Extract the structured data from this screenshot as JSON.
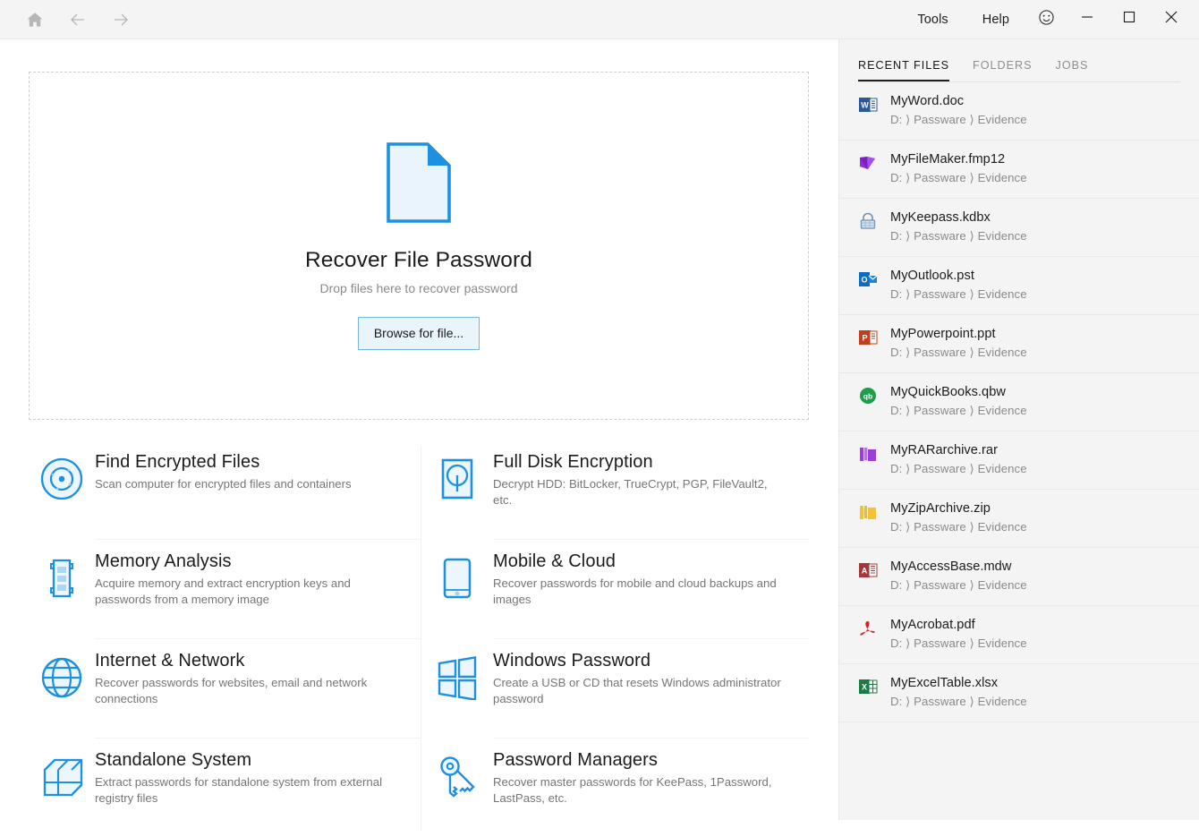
{
  "titlebar": {
    "nav": [
      {
        "name": "home-icon",
        "label": "Home"
      },
      {
        "name": "back-icon",
        "label": "Back"
      },
      {
        "name": "forward-icon",
        "label": "Forward"
      }
    ],
    "menus": [
      {
        "label": "Tools"
      },
      {
        "label": "Help"
      }
    ],
    "smiley_icon": "smiley-icon",
    "window_controls": [
      {
        "name": "minimize-button",
        "glyph": "─"
      },
      {
        "name": "maximize-button",
        "glyph": "□"
      },
      {
        "name": "close-button",
        "glyph": "✕"
      }
    ]
  },
  "dropzone": {
    "icon": "document-icon",
    "title": "Recover File Password",
    "subtitle": "Drop files here to recover password",
    "button": "Browse for file..."
  },
  "features": {
    "left": [
      {
        "icon": "radar-target-icon",
        "title": "Find Encrypted Files",
        "desc": "Scan computer for encrypted files and containers"
      },
      {
        "icon": "memory-module-icon",
        "title": "Memory Analysis",
        "desc": "Acquire memory and extract encryption keys and passwords from a memory image"
      },
      {
        "icon": "globe-icon",
        "title": "Internet & Network",
        "desc": "Recover passwords for websites, email and network connections"
      },
      {
        "icon": "cube-icon",
        "title": "Standalone System",
        "desc": "Extract passwords for standalone system from external registry files"
      }
    ],
    "right": [
      {
        "icon": "hard-disk-icon",
        "title": "Full Disk Encryption",
        "desc": "Decrypt HDD: BitLocker, TrueCrypt, PGP, FileVault2, etc."
      },
      {
        "icon": "mobile-phone-icon",
        "title": "Mobile & Cloud",
        "desc": "Recover passwords for mobile and cloud backups and images"
      },
      {
        "icon": "windows-logo-icon",
        "title": "Windows Password",
        "desc": "Create a USB or CD that resets Windows administrator password"
      },
      {
        "icon": "keys-icon",
        "title": "Password Managers",
        "desc": "Recover master passwords for KeePass, 1Password, LastPass, etc."
      }
    ]
  },
  "sidebar": {
    "tabs": [
      {
        "label": "RECENT FILES",
        "active": true
      },
      {
        "label": "FOLDERS",
        "active": false
      },
      {
        "label": "JOBS",
        "active": false
      }
    ],
    "files": [
      {
        "icon": "word-file-icon",
        "name": "MyWord.doc",
        "path": "D: ⟩ Passware ⟩ Evidence"
      },
      {
        "icon": "filemaker-file-icon",
        "name": "MyFileMaker.fmp12",
        "path": "D: ⟩ Passware ⟩ Evidence"
      },
      {
        "icon": "keepass-file-icon",
        "name": "MyKeepass.kdbx",
        "path": "D: ⟩ Passware ⟩ Evidence"
      },
      {
        "icon": "outlook-file-icon",
        "name": "MyOutlook.pst",
        "path": "D: ⟩ Passware ⟩ Evidence"
      },
      {
        "icon": "powerpoint-file-icon",
        "name": "MyPowerpoint.ppt",
        "path": "D: ⟩ Passware ⟩ Evidence"
      },
      {
        "icon": "quickbooks-file-icon",
        "name": "MyQuickBooks.qbw",
        "path": "D: ⟩ Passware ⟩ Evidence"
      },
      {
        "icon": "rar-file-icon",
        "name": "MyRARarchive.rar",
        "path": "D: ⟩ Passware ⟩ Evidence"
      },
      {
        "icon": "zip-file-icon",
        "name": "MyZipArchive.zip",
        "path": "D: ⟩ Passware ⟩ Evidence"
      },
      {
        "icon": "access-file-icon",
        "name": "MyAccessBase.mdw",
        "path": "D: ⟩ Passware ⟩ Evidence"
      },
      {
        "icon": "acrobat-file-icon",
        "name": "MyAcrobat.pdf",
        "path": "D: ⟩ Passware ⟩ Evidence"
      },
      {
        "icon": "excel-file-icon",
        "name": "MyExcelTable.xlsx",
        "path": "D: ⟩ Passware ⟩ Evidence"
      }
    ]
  },
  "colors": {
    "accent_blue": "#1e90e0",
    "icon_fill": "#ecf6fd",
    "titlebar_bg": "#f4f4f4",
    "sidebar_bg": "#f4f4f4",
    "text_primary": "#1b1b1b",
    "text_secondary": "#767676"
  }
}
